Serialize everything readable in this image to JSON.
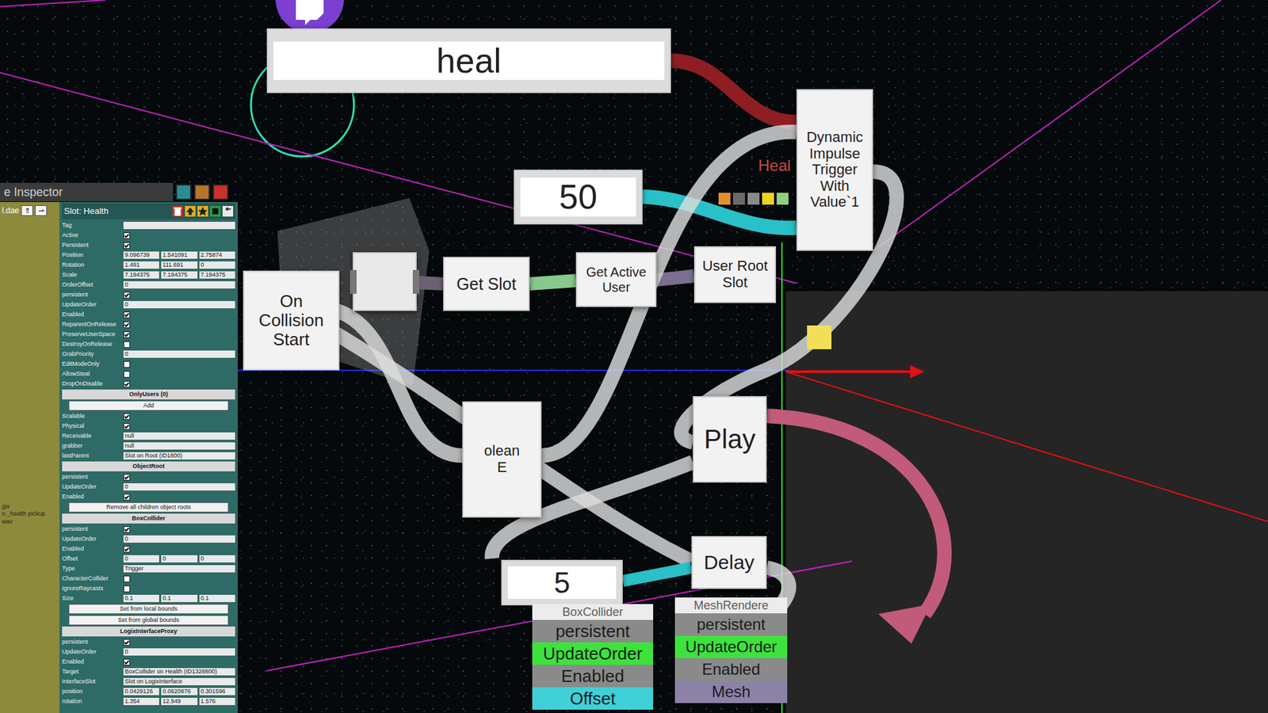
{
  "nodes": [
    {
      "kind": "input",
      "text": "heal"
    },
    {
      "kind": "logix",
      "text": "Dynamic Impulse Trigger With Value`1"
    },
    {
      "kind": "input",
      "text": "50"
    },
    {
      "kind": "blank",
      "text": ""
    },
    {
      "kind": "logix",
      "text": "Get Slot"
    },
    {
      "kind": "logix",
      "text": "Get Active User"
    },
    {
      "kind": "logix",
      "text": "User Root Slot"
    },
    {
      "kind": "logix",
      "text": "On Collision Start"
    },
    {
      "kind": "logix",
      "text": "olean\nE"
    },
    {
      "kind": "logix",
      "text": "Play"
    },
    {
      "kind": "logix",
      "text": "Delay"
    },
    {
      "kind": "input",
      "text": "5"
    }
  ],
  "ghost_label": "Heal",
  "components": [
    {
      "header": "BoxCollider",
      "fields": [
        {
          "label": "persistent",
          "color": "#8a8a8a"
        },
        {
          "label": "UpdateOrder",
          "color": "#3de23d"
        },
        {
          "label": "Enabled",
          "color": "#8a8a8a"
        },
        {
          "label": "Offset",
          "color": "#3fd0d8"
        }
      ]
    },
    {
      "header": "MeshRendere",
      "fields": [
        {
          "label": "persistent",
          "color": "#8a8a8a"
        },
        {
          "label": "UpdateOrder",
          "color": "#3de23d"
        },
        {
          "label": "Enabled",
          "color": "#8a8a8a"
        },
        {
          "label": "Mesh",
          "color": "#8c82a8"
        }
      ]
    }
  ],
  "inspector": {
    "tab": "e Inspector",
    "file": "l.dae",
    "nav": [
      "⇑",
      "⇀"
    ],
    "slot": "Slot: Health",
    "side": [
      "gix",
      "n _health pickup wav"
    ],
    "rows": [
      {
        "kind": "text",
        "label": "Tag",
        "value": ""
      },
      {
        "kind": "check",
        "label": "Active",
        "checked": true
      },
      {
        "kind": "check",
        "label": "Persistent",
        "checked": true
      },
      {
        "kind": "vec",
        "label": "Position",
        "values": [
          "9.096739",
          "1.541091",
          "2.75874"
        ]
      },
      {
        "kind": "vec",
        "label": "Rotation",
        "values": [
          "1.491",
          "111.691",
          "0"
        ]
      },
      {
        "kind": "vec",
        "label": "Scale",
        "values": [
          "7.194375",
          "7.194375",
          "7.194375"
        ]
      },
      {
        "kind": "text",
        "label": "OrderOffset",
        "value": "0"
      },
      {
        "kind": "check",
        "label": "persistent",
        "checked": true
      },
      {
        "kind": "text",
        "label": "UpdateOrder",
        "value": "0"
      },
      {
        "kind": "check",
        "label": "Enabled",
        "checked": true
      },
      {
        "kind": "check",
        "label": "ReparentOnRelease",
        "checked": true
      },
      {
        "kind": "check",
        "label": "PreserveUserSpace",
        "checked": true
      },
      {
        "kind": "check",
        "label": "DestroyOnRelease",
        "checked": false
      },
      {
        "kind": "text",
        "label": "GrabPriority",
        "value": "0"
      },
      {
        "kind": "check",
        "label": "EditModeOnly",
        "checked": false
      },
      {
        "kind": "check",
        "label": "AllowSteal",
        "checked": false
      },
      {
        "kind": "check",
        "label": "DropOnDisable",
        "checked": true
      },
      {
        "kind": "header",
        "label": "OnlyUsers (0)"
      },
      {
        "kind": "button",
        "label": "Add"
      },
      {
        "kind": "check",
        "label": "Scalable",
        "checked": true
      },
      {
        "kind": "check",
        "label": "Physical",
        "checked": true
      },
      {
        "kind": "text",
        "label": "Receivable",
        "value": "null"
      },
      {
        "kind": "text",
        "label": "grabber",
        "value": "null"
      },
      {
        "kind": "text",
        "label": "lastParent",
        "value": "Slot on Root (ID1800)"
      },
      {
        "kind": "header",
        "label": "ObjectRoot"
      },
      {
        "kind": "check",
        "label": "persistent",
        "checked": true
      },
      {
        "kind": "text",
        "label": "UpdateOrder",
        "value": "0"
      },
      {
        "kind": "check",
        "label": "Enabled",
        "checked": true
      },
      {
        "kind": "button",
        "label": "Remove all children object roots"
      },
      {
        "kind": "header",
        "label": "BoxCollider"
      },
      {
        "kind": "check",
        "label": "persistent",
        "checked": true
      },
      {
        "kind": "text",
        "label": "UpdateOrder",
        "value": "0"
      },
      {
        "kind": "check",
        "label": "Enabled",
        "checked": true
      },
      {
        "kind": "vec",
        "label": "Offset",
        "values": [
          "0",
          "0",
          "0"
        ]
      },
      {
        "kind": "text",
        "label": "Type",
        "value": "Trigger"
      },
      {
        "kind": "check",
        "label": "CharacterCollider",
        "checked": false
      },
      {
        "kind": "check",
        "label": "IgnoreRaycasts",
        "checked": false
      },
      {
        "kind": "vec",
        "label": "Size",
        "values": [
          "0.1",
          "0.1",
          "0.1"
        ]
      },
      {
        "kind": "button",
        "label": "Set from local bounds"
      },
      {
        "kind": "button",
        "label": "Set from global bounds"
      },
      {
        "kind": "header",
        "label": "LogixInterfaceProxy"
      },
      {
        "kind": "check",
        "label": "persistent",
        "checked": true
      },
      {
        "kind": "text",
        "label": "UpdateOrder",
        "value": "0"
      },
      {
        "kind": "check",
        "label": "Enabled",
        "checked": true
      },
      {
        "kind": "text",
        "label": "Target",
        "value": "BoxCollider on Health (ID1328800)"
      },
      {
        "kind": "text",
        "label": "InterfaceSlot",
        "value": "Slot on LogixInterface"
      },
      {
        "kind": "vec",
        "label": "position",
        "values": [
          "0.0429126",
          "0.0620876",
          "0.301596"
        ]
      },
      {
        "kind": "vec",
        "label": "rotation",
        "values": [
          "1.354",
          "12.949",
          "1.576"
        ]
      }
    ]
  }
}
